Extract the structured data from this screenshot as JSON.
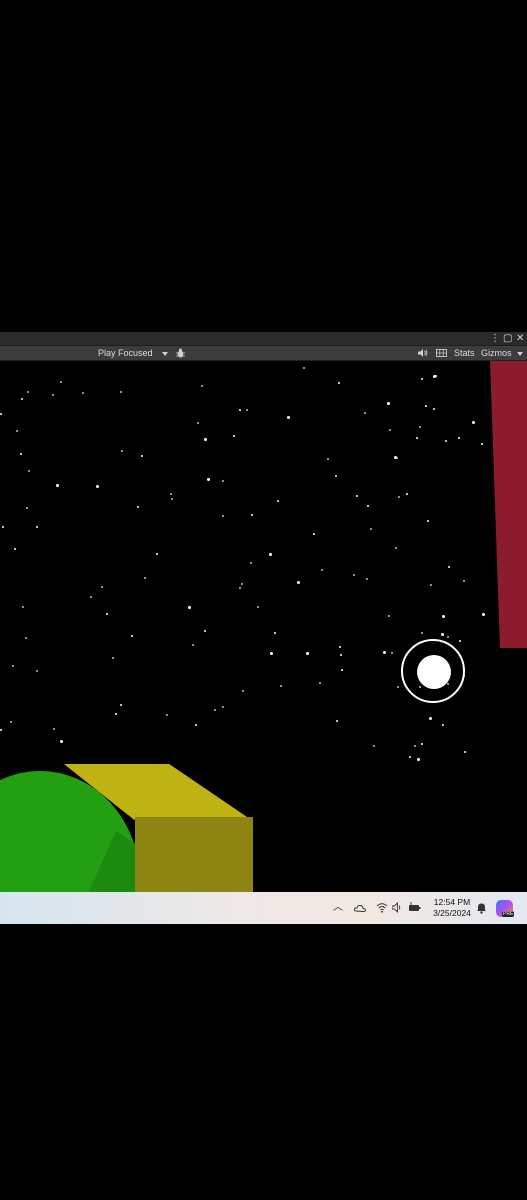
{
  "window": {
    "controls": [
      "more-icon",
      "maximize-icon",
      "close-icon"
    ]
  },
  "toolbar": {
    "play_mode_label": "Play Focused",
    "stats_label": "Stats",
    "gizmos_label": "Gizmos",
    "icons": [
      "bug-icon",
      "speaker-icon",
      "grid-icon"
    ]
  },
  "scene": {
    "background": "#000000",
    "objects": [
      {
        "name": "red-pillar",
        "color": "#8c1b2e"
      },
      {
        "name": "green-disc",
        "color": "#23a012"
      },
      {
        "name": "yellow-block",
        "color": "#bfb213"
      }
    ],
    "joystick_color": "#ffffff"
  },
  "taskbar": {
    "time": "12:54 PM",
    "date": "3/25/2024",
    "tray_icons": [
      "chevron-up-icon",
      "onedrive-icon",
      "wifi-icon",
      "volume-icon",
      "battery-icon",
      "notification-icon",
      "copilot-icon"
    ],
    "copilot_badge": "PRE"
  }
}
